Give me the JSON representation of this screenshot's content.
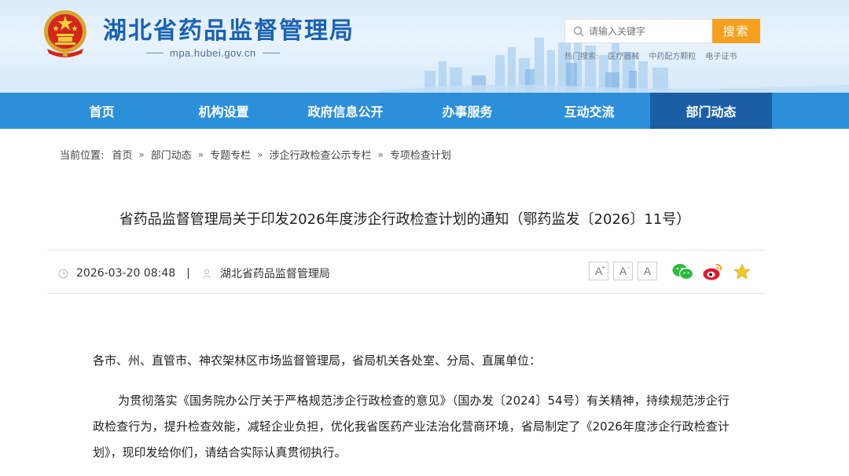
{
  "header": {
    "site_title": "湖北省药品监督管理局",
    "domain": "mpa.hubei.gov.cn",
    "search": {
      "placeholder": "请输入关键字",
      "button_label": "搜索"
    },
    "hot_words": [
      "热门搜索:",
      "医疗器械",
      "中药配方颗粒",
      "电子证书"
    ]
  },
  "nav": {
    "items": [
      "首页",
      "机构设置",
      "政府信息公开",
      "办事服务",
      "互动交流",
      "部门动态"
    ],
    "active_index": 5,
    "colors": {
      "bar": "#2c8fda",
      "active": "#1a5fa6"
    }
  },
  "breadcrumb": {
    "label": "当前位置:",
    "items": [
      "首页",
      "部门动态",
      "专题专栏",
      "涉企行政检查公示专栏",
      "专项检查计划"
    ],
    "separator": "»"
  },
  "article": {
    "title": "省药品监督管理局关于印发2026年度涉企行政检查计划的通知（鄂药监发〔2026〕11号）",
    "date": "2026-03-20 08:48",
    "divider": "|",
    "source": "湖北省药品监督管理局",
    "font_buttons": [
      "A",
      "A",
      "A"
    ],
    "font_button_marks": [
      "+",
      "-",
      ""
    ],
    "greeting": "各市、州、直管市、神农架林区市场监督管理局，省局机关各处室、分局、直属单位：",
    "paragraph": "为贯彻落实《国务院办公厅关于严格规范涉企行政检查的意见》（国办发〔2024〕54号）有关精神，持续规范涉企行政检查行为，提升检查效能，减轻企业负担，优化我省医药产业法治化营商环境，省局制定了《2026年度涉企行政检查计划》，现印发给你们，请结合实际认真贯彻执行。"
  },
  "share_icons": [
    "wechat-icon",
    "weibo-icon",
    "favorite-star-icon"
  ]
}
